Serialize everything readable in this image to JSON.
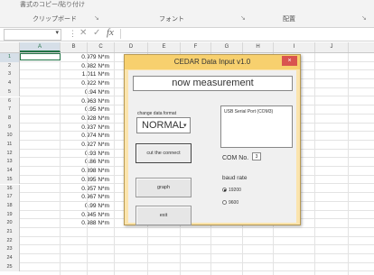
{
  "ribbon": {
    "top_text": "書式のコピー/貼り付け",
    "groups": [
      "クリップボード",
      "フォント",
      "配置"
    ]
  },
  "formula_bar": {
    "cancel_icon": "close-icon",
    "enter_icon": "check-icon",
    "fx_label": "fx"
  },
  "columns": [
    "A",
    "B",
    "C",
    "D",
    "E",
    "F",
    "G",
    "H",
    "I",
    "J"
  ],
  "rows": [
    "1",
    "2",
    "3",
    "4",
    "5",
    "6",
    "7",
    "8",
    "9",
    "10",
    "11",
    "12",
    "13",
    "14",
    "15",
    "16",
    "17",
    "18",
    "19",
    "20",
    "21",
    "22",
    "23",
    "24",
    "25"
  ],
  "values": [
    "0.979 N*m",
    "0.982 N*m",
    "1.011 N*m",
    "0.922 N*m",
    "0.94 N*m",
    "0.963 N*m",
    "0.95 N*m",
    "0.928 N*m",
    "0.937 N*m",
    "0.974 N*m",
    "0.927 N*m",
    "0.93 N*m",
    "0.86 N*m",
    "0.898 N*m",
    "0.895 N*m",
    "0.957 N*m",
    "0.967 N*m",
    "0.99 N*m",
    "0.945 N*m",
    "0.988 N*m"
  ],
  "dialog": {
    "title": "CEDAR Data Input v1.0",
    "close_label": "×",
    "measurement": "now measurement",
    "format_label": "change data format",
    "format_value": "NORMAL",
    "usb_port": "USB Serial Port (COM3)",
    "buttons": {
      "connect": "cut the connect",
      "graph": "graph",
      "exit": "exit"
    },
    "com_label": "COM No.",
    "com_value": "3",
    "baud_label": "baud rate",
    "baud_options": [
      "19200",
      "9600"
    ],
    "baud_selected": "19200"
  }
}
